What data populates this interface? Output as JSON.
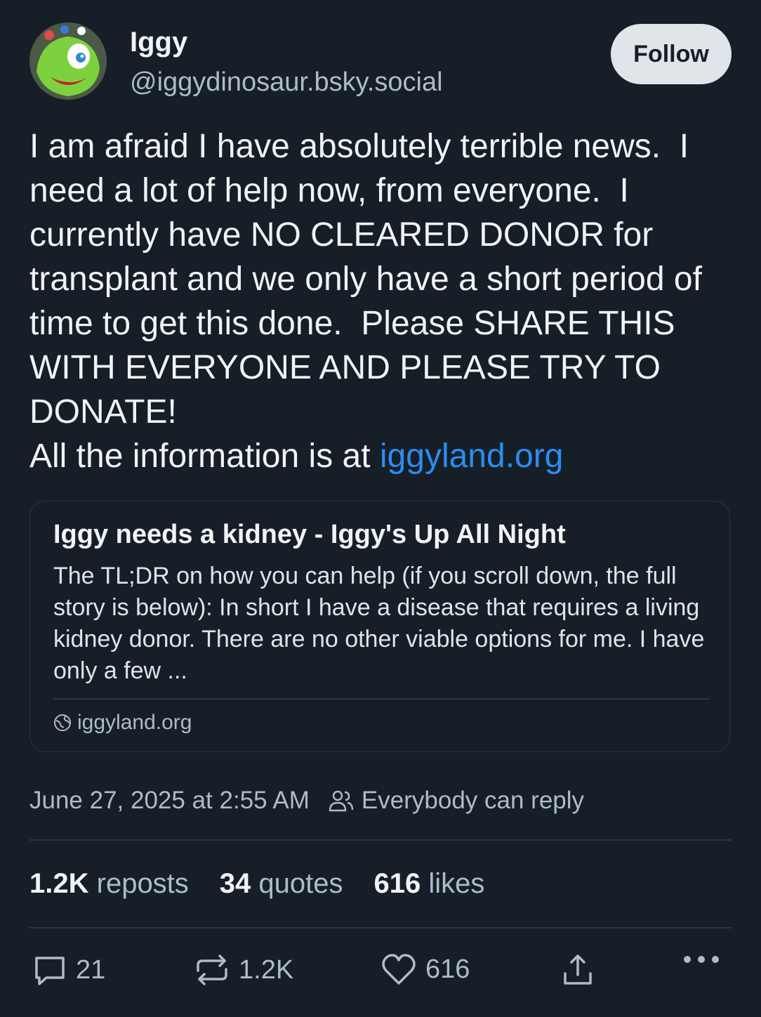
{
  "author": {
    "display_name": "Iggy",
    "handle": "@iggydinosaur.bsky.social"
  },
  "follow_label": "Follow",
  "post": {
    "text": "I am afraid I have absolutely terrible news.  I need a lot of help now, from everyone.  I currently have NO CLEARED DONOR for transplant and we only have a short period of time to get this done.  Please SHARE THIS WITH EVERYONE AND PLEASE TRY TO DONATE!\nAll the information is at ",
    "link_text": "iggyland.org"
  },
  "link_card": {
    "title": "Iggy needs a kidney - Iggy's Up All Night",
    "description": "The TL;DR on how you can help (if you scroll down, the full story is below): In short I have a disease that requires a living kidney donor. There are no other viable options for me. I have only a few ...",
    "domain": "iggyland.org"
  },
  "meta": {
    "timestamp": "June 27, 2025 at 2:55 AM",
    "reply_setting": "Everybody can reply"
  },
  "stats": {
    "reposts_count": "1.2K",
    "reposts_label": "reposts",
    "quotes_count": "34",
    "quotes_label": "quotes",
    "likes_count": "616",
    "likes_label": "likes"
  },
  "actions": {
    "reply_count": "21",
    "repost_count": "1.2K",
    "like_count": "616"
  },
  "colors": {
    "background": "#161e27",
    "link": "#2d8cf0",
    "muted": "#aebbc9"
  }
}
